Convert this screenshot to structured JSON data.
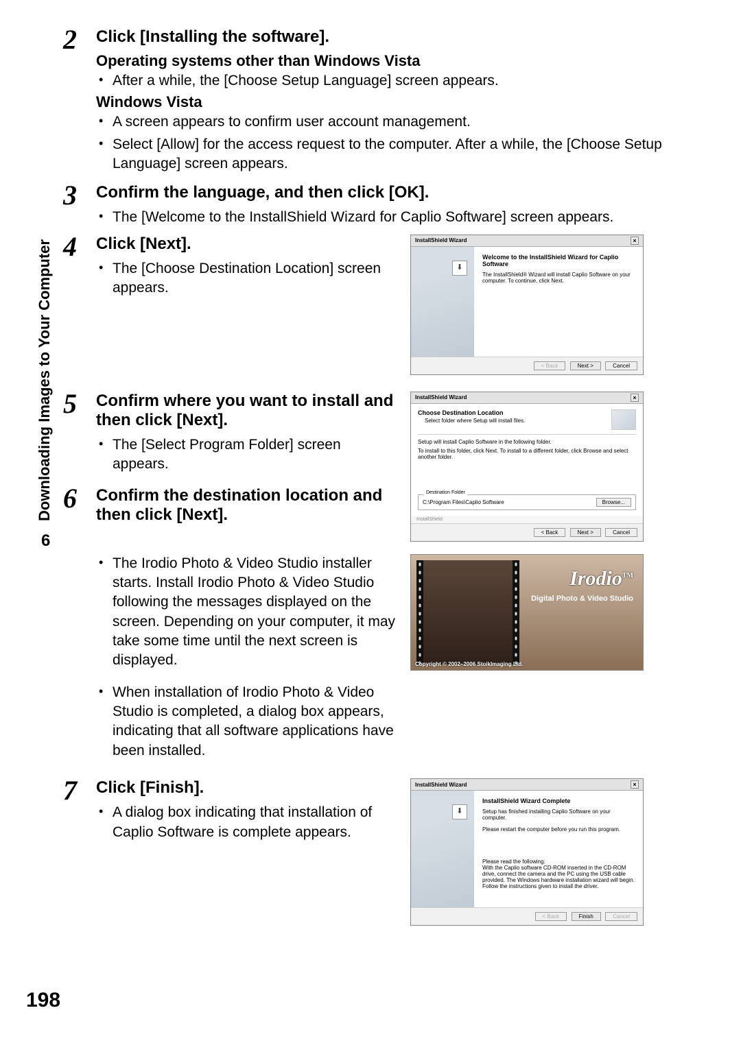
{
  "sidebar_title": "Downloading Images to Your Computer",
  "chapter_num": "6",
  "page_num": "198",
  "step2": {
    "num": "2",
    "title": "Click [Installing the software].",
    "sub1": "Operating systems other than Windows Vista",
    "b1": "After a while, the [Choose Setup Language] screen appears.",
    "sub2": "Windows Vista",
    "b2": "A screen appears to confirm user account management.",
    "b3": "Select [Allow] for the access request to the computer. After a while, the [Choose Setup Language] screen appears."
  },
  "step3": {
    "num": "3",
    "title": "Confirm the language, and then click [OK].",
    "b1": "The [Welcome to the InstallShield Wizard for Caplio Software] screen appears."
  },
  "step4": {
    "num": "4",
    "title": "Click [Next].",
    "b1": "The [Choose Destination Location] screen appears."
  },
  "step5": {
    "num": "5",
    "title": "Confirm where you want to install and then click [Next].",
    "b1": "The [Select Program Folder] screen appears."
  },
  "step6": {
    "num": "6",
    "title": "Confirm the destination location and then click [Next].",
    "b1": "The Irodio Photo & Video Studio installer starts. Install Irodio Photo & Video Studio following the messages displayed on the screen. Depending on your computer, it may take some time until the next screen is displayed.",
    "b2": "When installation of Irodio Photo & Video Studio is completed, a dialog box appears, indicating that all software applications have been installed."
  },
  "step7": {
    "num": "7",
    "title": "Click [Finish].",
    "b1": "A dialog box indicating that installation of Caplio Software is complete appears."
  },
  "wizard1": {
    "title": "InstallShield Wizard",
    "heading": "Welcome to the InstallShield Wizard for Caplio Software",
    "body": "The InstallShield® Wizard will install Caplio Software on your computer. To continue, click Next.",
    "back": "< Back",
    "next": "Next >",
    "cancel": "Cancel"
  },
  "wizard2": {
    "title": "InstallShield Wizard",
    "heading": "Choose Destination Location",
    "sub": "Select folder where Setup will install files.",
    "line1": "Setup will install Caplio Software in the following folder.",
    "line2": "To install to this folder, click Next. To install to a different folder, click Browse and select another folder.",
    "dest_label": "Destination Folder",
    "dest_path": "C:\\Program Files\\Caplio Software",
    "browse": "Browse...",
    "installshield": "InstallShield",
    "back": "< Back",
    "next": "Next >",
    "cancel": "Cancel"
  },
  "splash": {
    "brand": "Irodio",
    "tm": "TM",
    "sub": "Digital Photo & Video Studio",
    "copyright": "Copyright © 2002–2006 StoikImaging Ltd."
  },
  "wizard3": {
    "title": "InstallShield Wizard",
    "heading": "InstallShield Wizard Complete",
    "line1": "Setup has finished installing Caplio Software on your computer.",
    "line2": "Please restart the computer before you run this program.",
    "note_head": "Please read the following:",
    "note_body": "With the Caplio software CD-ROM inserted in the CD-ROM drive, connect the camera and the PC using the USB cable provided. The Windows hardware installation wizard will begin. Follow the instructions given to install the driver.",
    "back": "< Back",
    "finish": "Finish",
    "cancel": "Cancel"
  }
}
